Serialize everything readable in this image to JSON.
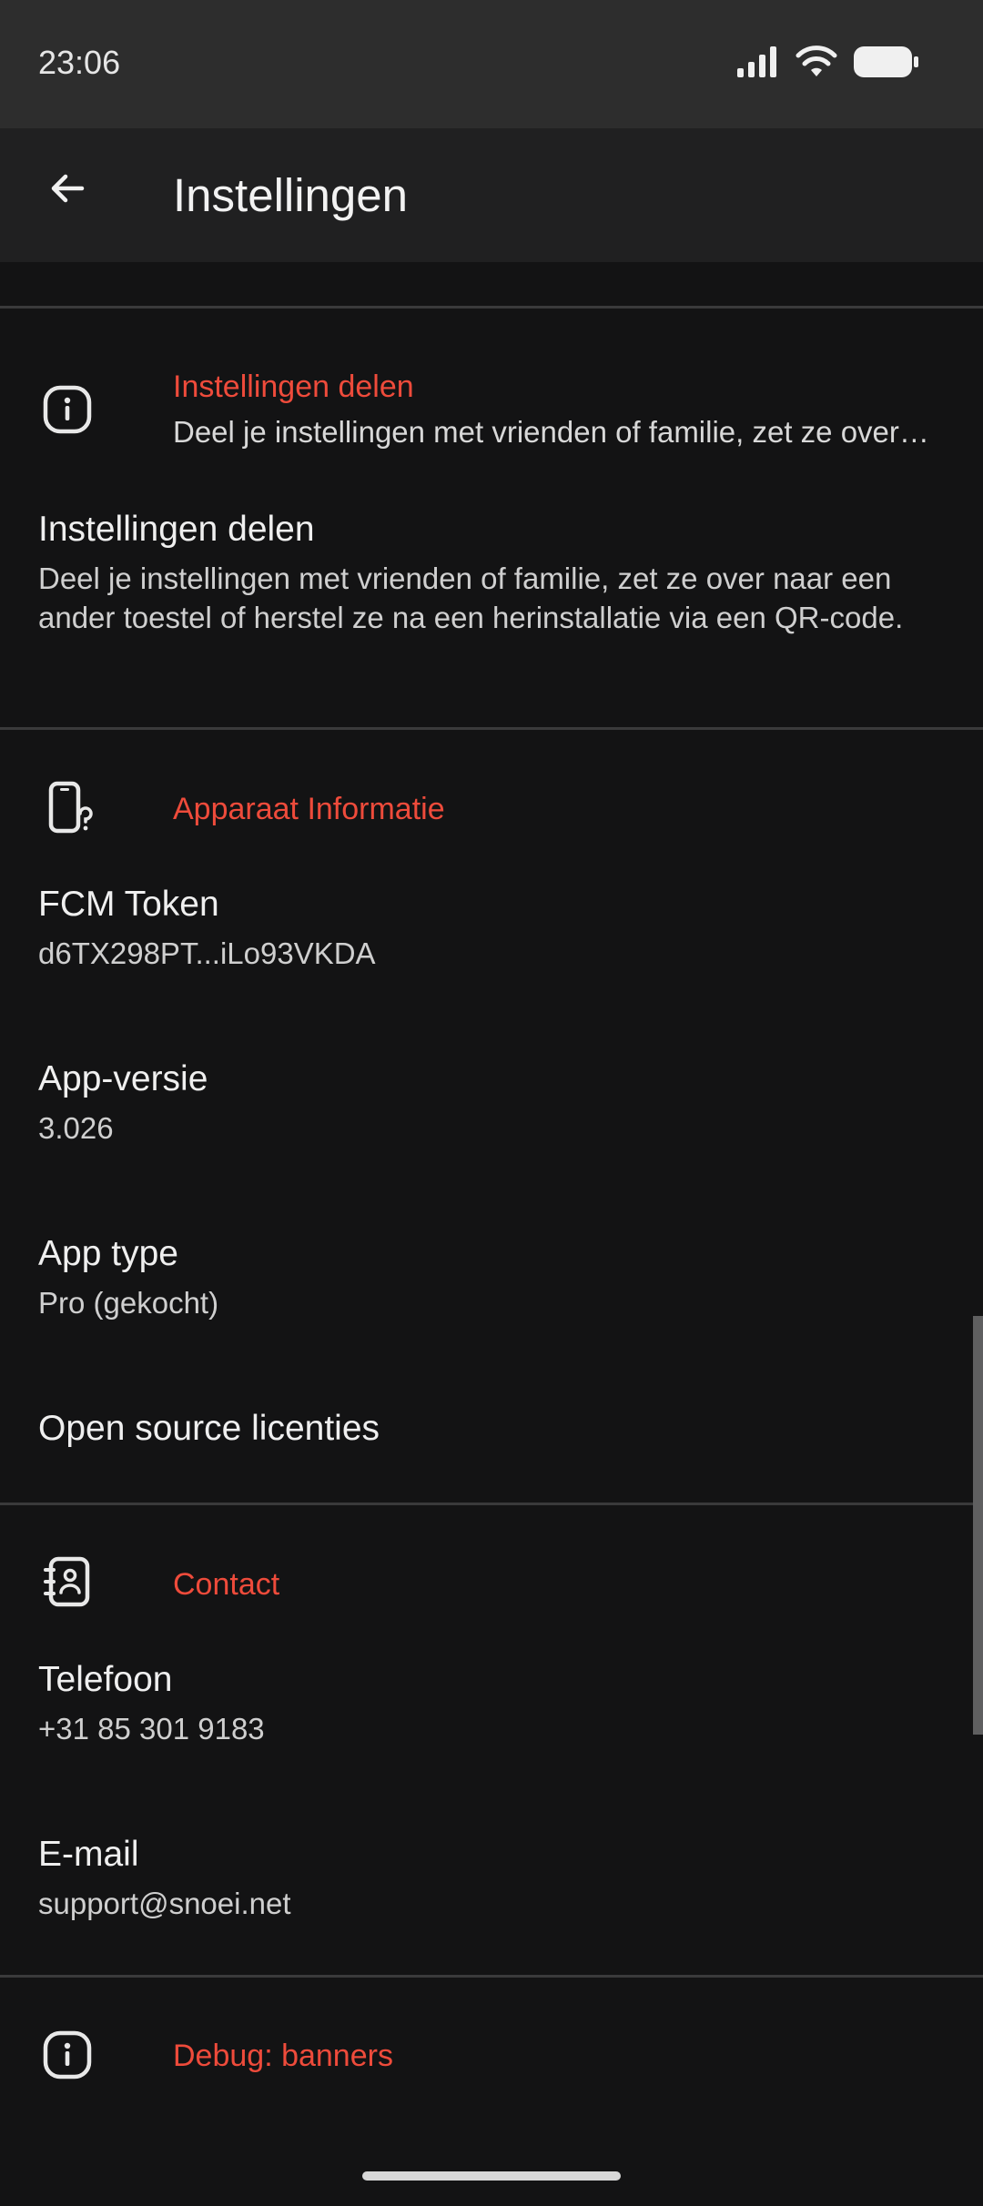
{
  "status_bar": {
    "time": "23:06",
    "icons": [
      "signal-icon",
      "wifi-icon",
      "battery-icon"
    ]
  },
  "app_bar": {
    "back_icon": "arrow-left-icon",
    "title": "Instellingen"
  },
  "sections": {
    "share": {
      "icon": "info-icon",
      "title": "Instellingen delen",
      "subtitle": "Deel je instellingen met vrienden of familie, zet ze over naar een ander toestel of herstel ze na een herinstallatie via een QR-code.",
      "pref_title": "Instellingen delen",
      "pref_summary": "Deel je instellingen met vrienden of familie, zet ze over naar een ander toestel of herstel ze na een herinstallatie via een QR-code."
    },
    "device": {
      "icon": "phone-question-icon",
      "title": "Apparaat Informatie",
      "fcm_title": "FCM Token",
      "fcm_value": "d6TX298PT...iLo93VKDA",
      "version_title": "App-versie",
      "version_value": "3.026",
      "type_title": "App type",
      "type_value": "Pro (gekocht)",
      "licenses_title": "Open source licenties"
    },
    "contact": {
      "icon": "contact-book-icon",
      "title": "Contact",
      "phone_title": "Telefoon",
      "phone_value": "+31 85 301 9183",
      "email_title": "E-mail",
      "email_value": "support@snoei.net"
    },
    "debug": {
      "icon": "info-icon",
      "title": "Debug: banners"
    }
  },
  "colors": {
    "accent": "#ee4b3b",
    "background": "#131314",
    "app_bar": "#202021",
    "status_bar": "#2d2d2d"
  }
}
